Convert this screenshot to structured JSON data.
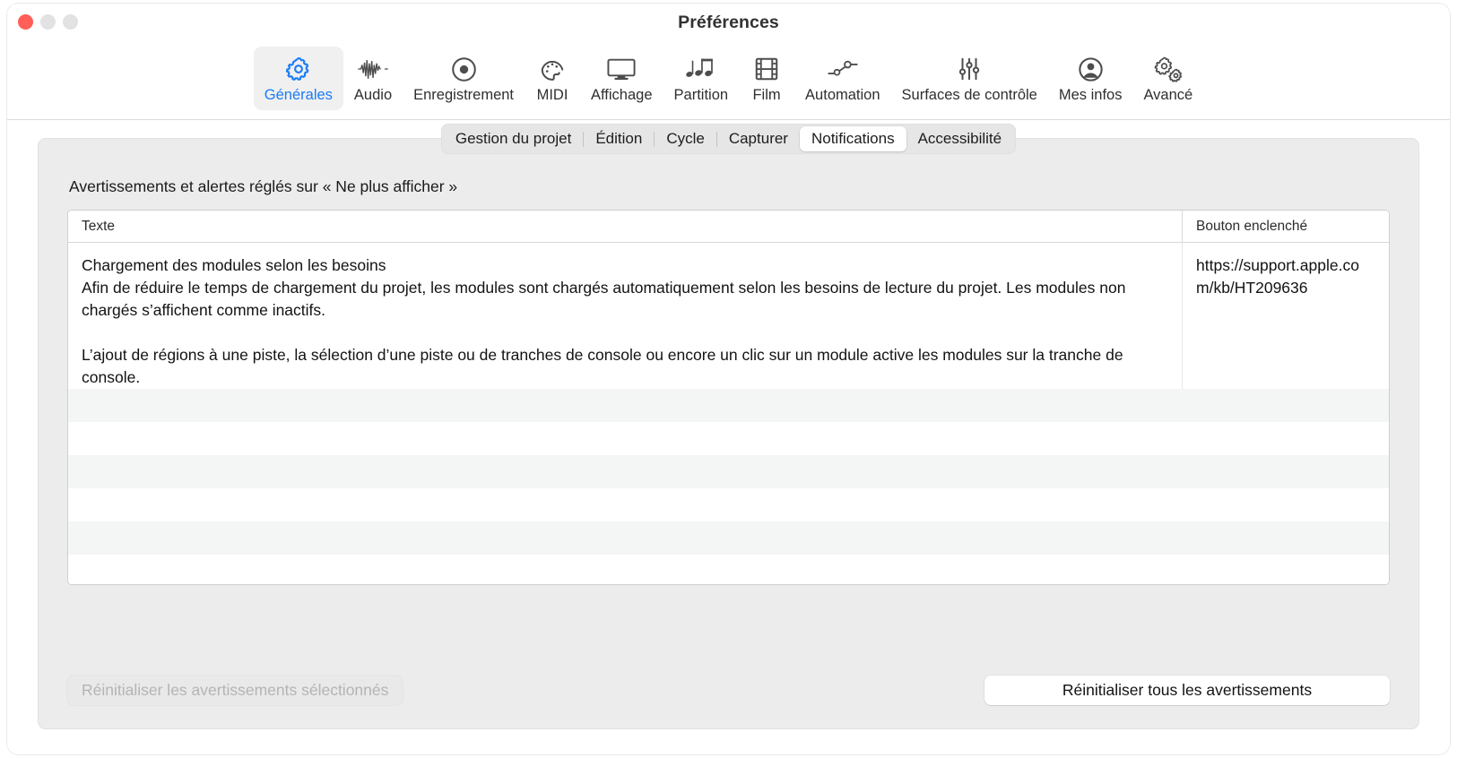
{
  "window": {
    "title": "Préférences",
    "traffic_lights": [
      "close-button",
      "minimize-button",
      "maximize-button"
    ]
  },
  "toolbar": {
    "items": [
      {
        "label": "Générales",
        "icon": "gear-icon",
        "selected": true
      },
      {
        "label": "Audio",
        "icon": "waveform-icon",
        "selected": false
      },
      {
        "label": "Enregistrement",
        "icon": "record-circle-icon",
        "selected": false
      },
      {
        "label": "MIDI",
        "icon": "midi-connector-icon",
        "selected": false
      },
      {
        "label": "Affichage",
        "icon": "display-monitor-icon",
        "selected": false
      },
      {
        "label": "Partition",
        "icon": "music-notes-icon",
        "selected": false
      },
      {
        "label": "Film",
        "icon": "film-strip-icon",
        "selected": false
      },
      {
        "label": "Automation",
        "icon": "automation-nodes-icon",
        "selected": false
      },
      {
        "label": "Surfaces de contrôle",
        "icon": "sliders-icon",
        "selected": false
      },
      {
        "label": "Mes infos",
        "icon": "person-circle-icon",
        "selected": false
      },
      {
        "label": "Avancé",
        "icon": "double-gear-icon",
        "selected": false
      }
    ]
  },
  "tabs": {
    "items": [
      {
        "label": "Gestion du projet",
        "active": false
      },
      {
        "label": "Édition",
        "active": false
      },
      {
        "label": "Cycle",
        "active": false
      },
      {
        "label": "Capturer",
        "active": false
      },
      {
        "label": "Notifications",
        "active": true
      },
      {
        "label": "Accessibilité",
        "active": false
      }
    ]
  },
  "main": {
    "section_heading": "Avertissements et alertes réglés sur « Ne plus afficher »",
    "table": {
      "columns": [
        "Texte",
        "Bouton enclenché"
      ],
      "rows": [
        {
          "title": "Chargement des modules selon les besoins",
          "paragraph1": "Afin de réduire le temps de chargement du projet, les modules sont chargés automatiquement selon les besoins de lecture du projet. Les modules non chargés s’affichent comme inactifs.",
          "paragraph2": "L’ajout de régions à une piste, la sélection d’une piste ou de tranches de console ou encore un clic sur un module active les modules sur la tranche de console.",
          "button_pressed": "https://support.apple.com/kb/HT209636"
        }
      ],
      "empty_row_count": 6
    }
  },
  "footer": {
    "reset_selected_label": "Réinitialiser les avertissements sélectionnés",
    "reset_selected_enabled": false,
    "reset_all_label": "Réinitialiser tous les avertissements",
    "reset_all_enabled": true
  },
  "colors": {
    "accent": "#1a7cf7",
    "close": "#ff5f56",
    "panel": "#ececec",
    "row_alt": "#f4f5f5"
  }
}
